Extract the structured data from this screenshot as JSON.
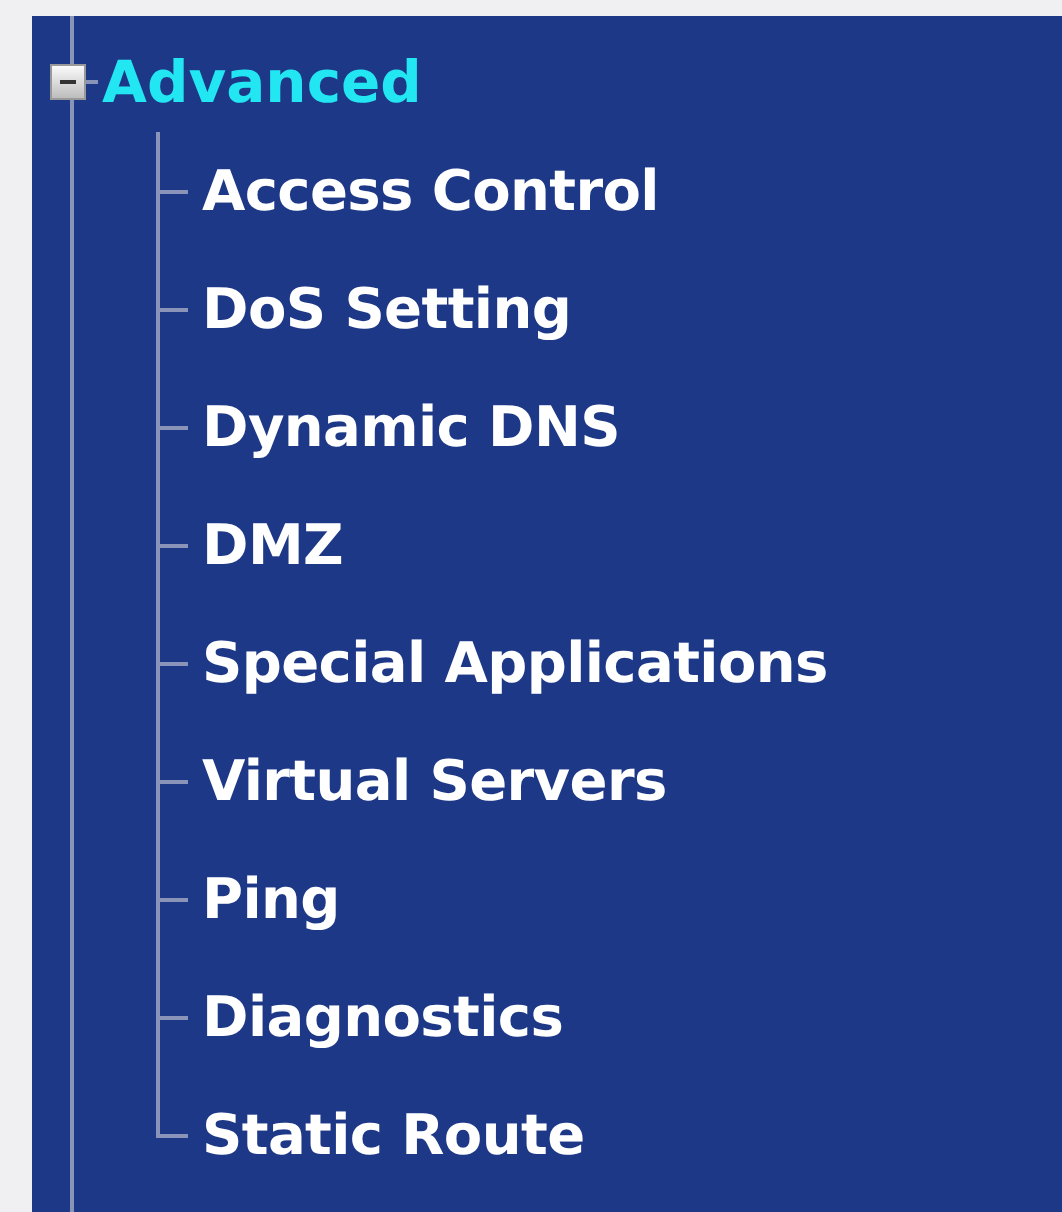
{
  "tree": {
    "label": "Advanced",
    "expanded": true,
    "children": [
      {
        "label": "Access Control"
      },
      {
        "label": "DoS Setting"
      },
      {
        "label": "Dynamic DNS"
      },
      {
        "label": "DMZ"
      },
      {
        "label": "Special Applications"
      },
      {
        "label": "Virtual Servers"
      },
      {
        "label": "Ping"
      },
      {
        "label": "Diagnostics"
      },
      {
        "label": "Static Route"
      }
    ]
  }
}
